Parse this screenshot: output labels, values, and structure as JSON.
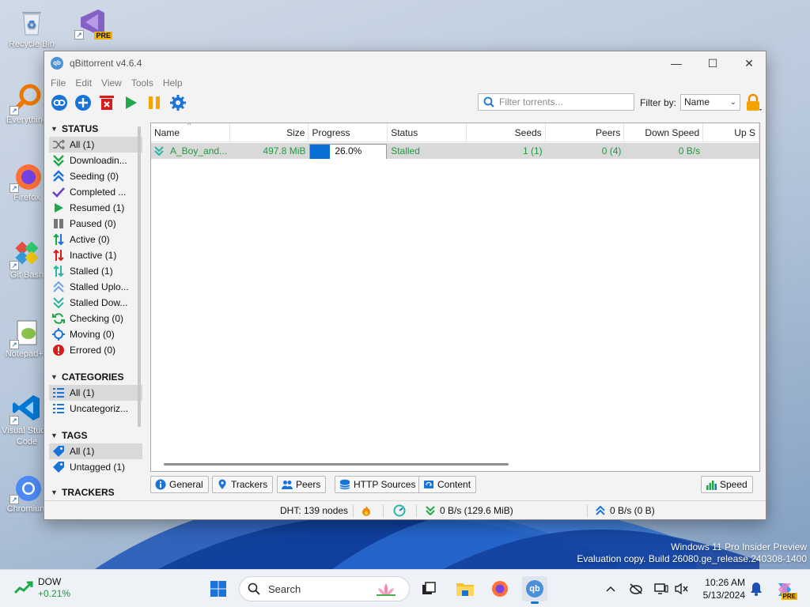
{
  "desktop": {
    "icons": [
      {
        "name": "recycle-bin",
        "label": "Recycle Bin"
      },
      {
        "name": "visual-studio-preview",
        "label": "Visual Studio",
        "badge": "PRE"
      },
      {
        "name": "everything",
        "label": "Everything"
      },
      {
        "name": "firefox",
        "label": "Firefox"
      },
      {
        "name": "git-bash",
        "label": "Git Bash"
      },
      {
        "name": "notepad",
        "label": "Notepad++"
      },
      {
        "name": "vscode",
        "label": "Visual Studio Code"
      },
      {
        "name": "chromium",
        "label": "Chromium"
      }
    ],
    "watermark_line1": "Windows 11 Pro Insider Preview",
    "watermark_line2": "Evaluation copy. Build 26080.ge_release.240308-1400"
  },
  "window": {
    "title": "qBittorrent v4.6.4",
    "app_icon_text": "qb",
    "controls": {
      "minimize": "—",
      "maximize": "☐",
      "close": "✕"
    }
  },
  "menu": [
    "File",
    "Edit",
    "View",
    "Tools",
    "Help"
  ],
  "toolbar": {
    "search_placeholder": "Filter torrents...",
    "filter_label": "Filter by:",
    "filter_value": "Name"
  },
  "sidebar": {
    "status_header": "STATUS",
    "status_items": [
      {
        "label": "All (1)",
        "icon": "shuffle-icon",
        "selected": true
      },
      {
        "label": "Downloadin...",
        "icon": "download-icon"
      },
      {
        "label": "Seeding (0)",
        "icon": "upload-icon"
      },
      {
        "label": "Completed ...",
        "icon": "checkmark-icon"
      },
      {
        "label": "Resumed (1)",
        "icon": "play-icon"
      },
      {
        "label": "Paused (0)",
        "icon": "pause-icon"
      },
      {
        "label": "Active (0)",
        "icon": "active-arrows-icon"
      },
      {
        "label": "Inactive (1)",
        "icon": "inactive-arrows-icon"
      },
      {
        "label": "Stalled (1)",
        "icon": "stalled-arrows-icon"
      },
      {
        "label": "Stalled Uplo...",
        "icon": "stalled-upload-icon"
      },
      {
        "label": "Stalled Dow...",
        "icon": "stalled-download-icon"
      },
      {
        "label": "Checking (0)",
        "icon": "refresh-icon"
      },
      {
        "label": "Moving (0)",
        "icon": "move-icon"
      },
      {
        "label": "Errored (0)",
        "icon": "error-icon"
      }
    ],
    "categories_header": "CATEGORIES",
    "category_items": [
      {
        "label": "All (1)",
        "selected": true
      },
      {
        "label": "Uncategoriz..."
      }
    ],
    "tags_header": "TAGS",
    "tag_items": [
      {
        "label": "All (1)",
        "selected": true
      },
      {
        "label": "Untagged (1)"
      }
    ],
    "trackers_header": "TRACKERS"
  },
  "torrent_list": {
    "columns": [
      "Name",
      "Size",
      "Progress",
      "Status",
      "Seeds",
      "Peers",
      "Down Speed",
      "Up S"
    ],
    "rows": [
      {
        "name": "A_Boy_and...",
        "size": "497.8 MiB",
        "progress": 0.26,
        "progress_text": "26.0%",
        "status": "Stalled",
        "seeds": "1 (1)",
        "peers": "0 (4)",
        "down_speed": "0 B/s",
        "up_speed": ""
      }
    ]
  },
  "bottom_tabs": [
    "General",
    "Trackers",
    "Peers",
    "HTTP Sources",
    "Content"
  ],
  "speed_button": "Speed",
  "statusbar": {
    "dht": "DHT: 139 nodes",
    "download": "0 B/s (129.6 MiB)",
    "upload": "0 B/s (0 B)"
  },
  "taskbar": {
    "widget_title": "DOW",
    "widget_value": "+0.21%",
    "search_text": "Search",
    "time": "10:26 AM",
    "date": "5/13/2024",
    "qb_text": "qb",
    "copilot_badge": "PRE"
  },
  "colors": {
    "accent_blue": "#1a73d9",
    "green": "#1e9a3f",
    "orange": "#f5a300",
    "red": "#d81b1b"
  }
}
